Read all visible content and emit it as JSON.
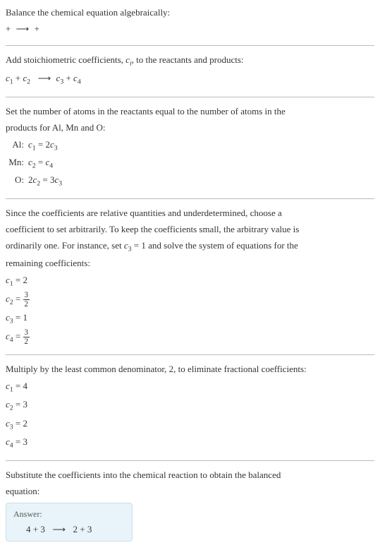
{
  "intro": {
    "line1": "Balance the chemical equation algebraically:",
    "line2_pre": " + ",
    "line2_arrow": "⟶",
    "line2_post": " + "
  },
  "stoich": {
    "line1_pre": "Add stoichiometric coefficients, ",
    "line1_var": "c",
    "line1_sub": "i",
    "line1_post": ", to the reactants and products:",
    "eq_c1": "c",
    "eq_s1": "1",
    "eq_plus1": " + ",
    "eq_c2": "c",
    "eq_s2": "2",
    "eq_arrow": "⟶",
    "eq_c3": "c",
    "eq_s3": "3",
    "eq_plus2": " + ",
    "eq_c4": "c",
    "eq_s4": "4"
  },
  "atoms": {
    "line1": "Set the number of atoms in the reactants equal to the number of atoms in the",
    "line2": "products for Al, Mn and O:",
    "rows": [
      {
        "label": "Al:",
        "lhs_c": "c",
        "lhs_s": "1",
        "eq": " = 2",
        "rhs_c": "c",
        "rhs_s": "3"
      },
      {
        "label": "Mn:",
        "lhs_c": "c",
        "lhs_s": "2",
        "eq": " = ",
        "rhs_c": "c",
        "rhs_s": "4"
      },
      {
        "label": "O:",
        "pre": "2",
        "lhs_c": "c",
        "lhs_s": "2",
        "eq": " = 3",
        "rhs_c": "c",
        "rhs_s": "3"
      }
    ]
  },
  "choose": {
    "line1": "Since the coefficients are relative quantities and underdetermined, choose a",
    "line2": "coefficient to set arbitrarily. To keep the coefficients small, the arbitrary value is",
    "line3_pre": "ordinarily one. For instance, set ",
    "line3_c": "c",
    "line3_s": "3",
    "line3_mid": " = 1 and solve the system of equations for the",
    "line4": "remaining coefficients:",
    "eq1_c": "c",
    "eq1_s": "1",
    "eq1_v": " = 2",
    "eq2_c": "c",
    "eq2_s": "2",
    "eq2_eq": " = ",
    "eq2_num": "3",
    "eq2_den": "2",
    "eq3_c": "c",
    "eq3_s": "3",
    "eq3_v": " = 1",
    "eq4_c": "c",
    "eq4_s": "4",
    "eq4_eq": " = ",
    "eq4_num": "3",
    "eq4_den": "2"
  },
  "multiply": {
    "line1": "Multiply by the least common denominator, 2, to eliminate fractional coefficients:",
    "eq1_c": "c",
    "eq1_s": "1",
    "eq1_v": " = 4",
    "eq2_c": "c",
    "eq2_s": "2",
    "eq2_v": " = 3",
    "eq3_c": "c",
    "eq3_s": "3",
    "eq3_v": " = 2",
    "eq4_c": "c",
    "eq4_s": "4",
    "eq4_v": " = 3"
  },
  "substitute": {
    "line1": "Substitute the coefficients into the chemical reaction to obtain the balanced",
    "line2": "equation:"
  },
  "answer": {
    "label": "Answer:",
    "v1": "4 ",
    "plus1": " + 3 ",
    "arrow": "⟶",
    "v3": " 2 ",
    "plus2": " + 3 "
  }
}
